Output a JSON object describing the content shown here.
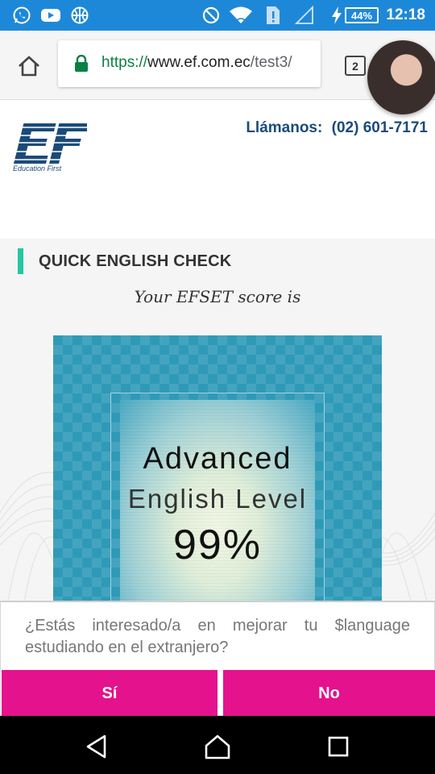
{
  "status_bar": {
    "time": "12:18",
    "battery": "44%",
    "battery_level_percent": 44,
    "icons": [
      "whatsapp-icon",
      "youtube-icon",
      "basketball-icon",
      "do-not-disturb-icon",
      "wifi-icon",
      "sim-alert-icon",
      "signal-icon",
      "charging-bolt-icon",
      "battery-icon"
    ]
  },
  "browser": {
    "url_scheme": "https://",
    "url_host": "www.ef.com.ec",
    "url_path": "/test3/",
    "tab_count": "2"
  },
  "header": {
    "logo_text": "EF",
    "logo_subtitle": "Education First",
    "call_label": "Llámanos:",
    "phone": "(02) 601-7171"
  },
  "section": {
    "title": "QUICK ENGLISH CHECK",
    "score_intro": "Your EFSET score is"
  },
  "certificate": {
    "level": "Advanced",
    "level_label": "English Level",
    "percent": "99%"
  },
  "prompt": {
    "question": "¿Estás interesado/a en mejorar tu $language estudiando en el extranjero?",
    "yes": "Sí",
    "no": "No"
  },
  "colors": {
    "status_bar": "#1e88d8",
    "brand_blue": "#1b4b7a",
    "accent_green": "#25c6a3",
    "cert_teal": "#2f9ab8",
    "button_pink": "#e4128d"
  }
}
